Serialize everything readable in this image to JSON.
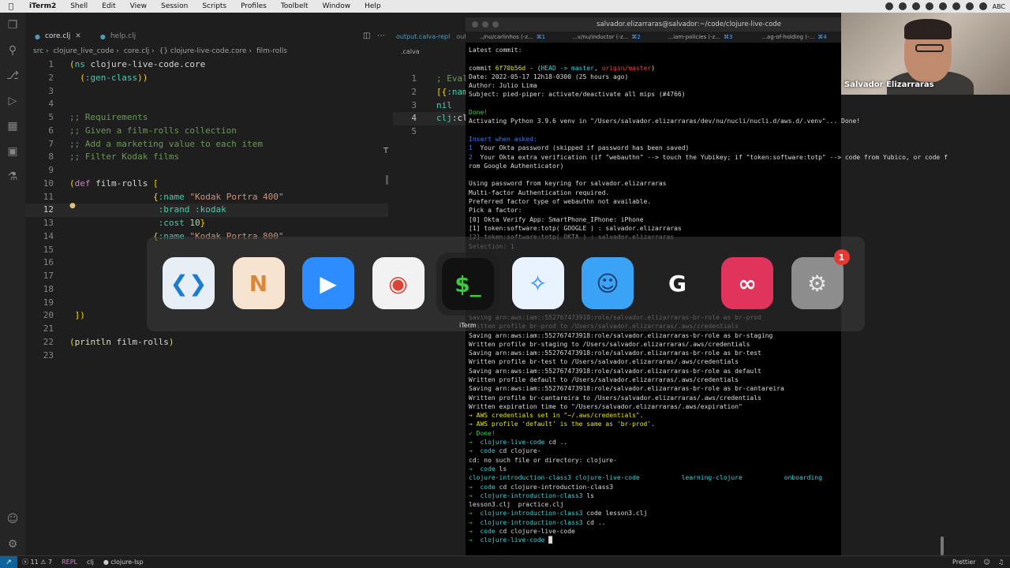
{
  "menubar": {
    "items": [
      "iTerm2",
      "Shell",
      "Edit",
      "View",
      "Session",
      "Scripts",
      "Profiles",
      "Toolbelt",
      "Window",
      "Help"
    ],
    "input_source": "ABC"
  },
  "editor": {
    "tabs": [
      {
        "label": "core.clj",
        "active": true
      },
      {
        "label": "help.clj",
        "active": false
      }
    ],
    "breadcrumb": [
      "src",
      "clojure_live_code",
      "core.clj",
      "{} clojure-live-code.core",
      "film-rolls"
    ],
    "lines": [
      {
        "n": "1",
        "parts": [
          [
            "k-paren",
            "("
          ],
          [
            "k-kw",
            "ns "
          ],
          [
            "",
            "clojure-live-code.core"
          ]
        ]
      },
      {
        "n": "2",
        "parts": [
          [
            "",
            "  "
          ],
          [
            "k-paren",
            "("
          ],
          [
            "k-kw",
            ":gen-class"
          ],
          [
            "k-paren",
            ")"
          ],
          [
            "k-paren",
            ")"
          ]
        ]
      },
      {
        "n": "3",
        "parts": []
      },
      {
        "n": "4",
        "parts": []
      },
      {
        "n": "5",
        "parts": [
          [
            "k-cm",
            ";; Requirements"
          ]
        ]
      },
      {
        "n": "6",
        "parts": [
          [
            "k-cm",
            ";; Given a film-rolls collection"
          ]
        ]
      },
      {
        "n": "7",
        "parts": [
          [
            "k-cm",
            ";; Add a marketing value to each item"
          ]
        ]
      },
      {
        "n": "8",
        "parts": [
          [
            "k-cm",
            ";; Filter Kodak films"
          ]
        ]
      },
      {
        "n": "9",
        "parts": []
      },
      {
        "n": "10",
        "parts": [
          [
            "k-paren",
            "("
          ],
          [
            "k-def",
            "def "
          ],
          [
            "",
            "film-rolls "
          ],
          [
            "k-paren",
            "["
          ]
        ]
      },
      {
        "n": "11",
        "parts": [
          [
            "",
            "                "
          ],
          [
            "k-paren",
            "{"
          ],
          [
            "k-kw",
            ":name "
          ],
          [
            "k-str",
            "\"Kodak Portra 400\""
          ]
        ]
      },
      {
        "n": "12",
        "parts": [
          [
            "",
            "                 "
          ],
          [
            "k-kw",
            ":brand :kodak"
          ]
        ],
        "current": true
      },
      {
        "n": "13",
        "parts": [
          [
            "",
            "                 "
          ],
          [
            "k-kw",
            ":cost "
          ],
          [
            "k-num",
            "10"
          ],
          [
            "k-paren",
            "}"
          ]
        ]
      },
      {
        "n": "14",
        "parts": [
          [
            "",
            "                "
          ],
          [
            "k-paren",
            "{"
          ],
          [
            "k-kw",
            ":name "
          ],
          [
            "k-str",
            "\"Kodak Portra 800\""
          ]
        ]
      },
      {
        "n": "15",
        "parts": []
      },
      {
        "n": "16",
        "parts": []
      },
      {
        "n": "17",
        "parts": []
      },
      {
        "n": "18",
        "parts": []
      },
      {
        "n": "19",
        "parts": []
      },
      {
        "n": "20",
        "parts": [
          [
            "",
            " "
          ],
          [
            "k-paren",
            "]"
          ],
          [
            "k-paren",
            ")"
          ]
        ]
      },
      {
        "n": "21",
        "parts": []
      },
      {
        "n": "22",
        "parts": [
          [
            "k-paren",
            "("
          ],
          [
            "k-fn",
            "println "
          ],
          [
            "",
            "film-rolls"
          ],
          [
            "k-paren",
            ")"
          ]
        ]
      },
      {
        "n": "23",
        "parts": []
      }
    ],
    "right_tabs": [
      "output.calva-repl",
      "output-window"
    ],
    "right_crumb": ".calva",
    "right_lines": [
      {
        "n": "1",
        "parts": [
          [
            "k-cm",
            "; Eval"
          ]
        ]
      },
      {
        "n": "2",
        "parts": [
          [
            "k-paren",
            "[{"
          ],
          [
            "k-kw",
            ":name"
          ]
        ]
      },
      {
        "n": "3",
        "parts": [
          [
            "k-kw",
            "nil"
          ]
        ]
      },
      {
        "n": "4",
        "parts": [
          [
            "k-kw",
            "clj"
          ],
          [
            "",
            ":cl"
          ]
        ],
        "current": true
      },
      {
        "n": "5",
        "parts": []
      }
    ]
  },
  "statusbar": {
    "problems": "ⓧ 11 ⚠ 7",
    "repl": "REPL",
    "lang": "clj",
    "lsp": "● clojure-lsp",
    "prettier": "Prettier"
  },
  "iterm": {
    "title": "salvador.elizarraras@salvador:~/code/clojure-live-code",
    "tabs": [
      {
        "label": "../nu/carlinhos (-z...",
        "shortcut": "⌘1"
      },
      {
        "label": "...v/nu/inductor (-z...",
        "shortcut": "⌘2"
      },
      {
        "label": "...iam-policies (-z...",
        "shortcut": "⌘3"
      },
      {
        "label": "...ag-of-holding (-...",
        "shortcut": "⌘4"
      }
    ],
    "lines": [
      [
        [
          "",
          "Latest commit:"
        ]
      ],
      [],
      [
        [
          "",
          "commit "
        ],
        [
          "t-yellow",
          "6f70b56d"
        ],
        [
          "",
          " - ("
        ],
        [
          "t-cyan",
          "HEAD -> master"
        ],
        [
          "",
          ", "
        ],
        [
          "t-red",
          "origin/master"
        ],
        [
          "",
          ")"
        ]
      ],
      [
        [
          "",
          "Date: 2022-05-17 12h18-0300 (25 hours ago)"
        ]
      ],
      [
        [
          "",
          "Author: Julio Lima"
        ]
      ],
      [
        [
          "",
          "Subject: pied-piper: activate/deactivate all mips (#4766)"
        ]
      ],
      [],
      [
        [
          "t-green",
          "Done!"
        ]
      ],
      [
        [
          "",
          "Activating Python 3.9.6 venv in \"/Users/salvador.elizarraras/dev/nu/nucli/nucli.d/aws.d/.venv\"... Done!"
        ]
      ],
      [],
      [
        [
          "t-blue",
          "Insert when asked:"
        ]
      ],
      [
        [
          "t-blue",
          "1"
        ],
        [
          "",
          "  Your Okta password (skipped if password has been saved)"
        ]
      ],
      [
        [
          "t-blue",
          "2"
        ],
        [
          "",
          "  Your Okta extra verification (if \"webauthn\" --> touch the Yubikey; if \"token:software:totp\" --> code from Yubico, or code f"
        ]
      ],
      [
        [
          "",
          "rom Google Authenticator)"
        ]
      ],
      [],
      [
        [
          "",
          "Using password from keyring for salvador.elizarraras"
        ]
      ],
      [
        [
          "",
          "Multi-factor Authentication required."
        ]
      ],
      [
        [
          "",
          "Preferred factor type of webauthn not available."
        ]
      ],
      [
        [
          "",
          "Pick a factor:"
        ]
      ],
      [
        [
          "",
          "[0] Okta Verify App: SmartPhone_IPhone: iPhone"
        ]
      ],
      [
        [
          "",
          "[1] token:software:totp( GOOGLE ) : salvador.elizarraras"
        ]
      ],
      [
        [
          "t-dim",
          "[2] token:software:totp( OKTA ) : salvador.elizarraras"
        ]
      ],
      [
        [
          "t-dim",
          "Selection: 1"
        ]
      ],
      [],
      [],
      [],
      [],
      [],
      [],
      [],
      [
        [
          "t-dim",
          "Saving arn:aws:iam::552767473918:role/salvador.elizarraras-br-role as br-prod"
        ]
      ],
      [
        [
          "t-dim",
          "Written profile br-prod to /Users/salvador.elizarraras/.aws/credentials"
        ]
      ],
      [
        [
          "",
          "Saving arn:aws:iam::552767473918:role/salvador.elizarraras-br-role as br-staging"
        ]
      ],
      [
        [
          "",
          "Written profile br-staging to /Users/salvador.elizarraras/.aws/credentials"
        ]
      ],
      [
        [
          "",
          "Saving arn:aws:iam::552767473918:role/salvador.elizarraras-br-role as br-test"
        ]
      ],
      [
        [
          "",
          "Written profile br-test to /Users/salvador.elizarraras/.aws/credentials"
        ]
      ],
      [
        [
          "",
          "Saving arn:aws:iam::552767473918:role/salvador.elizarraras-br-role as default"
        ]
      ],
      [
        [
          "",
          "Written profile default to /Users/salvador.elizarraras/.aws/credentials"
        ]
      ],
      [
        [
          "",
          "Saving arn:aws:iam::552767473918:role/salvador.elizarraras-br-role as br-cantareira"
        ]
      ],
      [
        [
          "",
          "Written profile br-cantareira to /Users/salvador.elizarraras/.aws/credentials"
        ]
      ],
      [
        [
          "",
          "Written expiration time to \"/Users/salvador.elizarraras/.aws/expiration\""
        ]
      ],
      [
        [
          "t-yellow",
          "→ AWS credentials set in \"~/.aws/credentials\"."
        ]
      ],
      [
        [
          "t-yellow",
          "→ AWS profile 'default' is the same as 'br-prod'."
        ]
      ],
      [
        [
          "t-green",
          "✓ Done!"
        ]
      ],
      [
        [
          "t-green",
          "→  "
        ],
        [
          "t-cyan",
          "clojure-live-code"
        ],
        [
          "",
          " cd .."
        ]
      ],
      [
        [
          "t-green",
          "→  "
        ],
        [
          "t-cyan",
          "code"
        ],
        [
          "",
          " cd clojure-"
        ]
      ],
      [
        [
          "",
          "cd: no such file or directory: clojure-"
        ]
      ],
      [
        [
          "t-green",
          "→  "
        ],
        [
          "t-cyan",
          "code"
        ],
        [
          "",
          " ls"
        ]
      ],
      [
        [
          "t-cyan",
          "clojure-introduction-class3 clojure-live-code           learning-clojure           onboarding"
        ]
      ],
      [
        [
          "t-green",
          "→  "
        ],
        [
          "t-cyan",
          "code"
        ],
        [
          "",
          " cd clojure-introduction-class3"
        ]
      ],
      [
        [
          "t-green",
          "→  "
        ],
        [
          "t-cyan",
          "clojure-introduction-class3"
        ],
        [
          "",
          " ls"
        ]
      ],
      [
        [
          "",
          "lesson3.clj  practice.clj"
        ]
      ],
      [
        [
          "t-green",
          "→  "
        ],
        [
          "t-cyan",
          "clojure-introduction-class3"
        ],
        [
          "",
          " code lesson3.clj"
        ]
      ],
      [
        [
          "t-green",
          "→  "
        ],
        [
          "t-cyan",
          "clojure-introduction-class3"
        ],
        [
          "",
          " cd .."
        ]
      ],
      [
        [
          "t-green",
          "→  "
        ],
        [
          "t-cyan",
          "code"
        ],
        [
          "",
          " cd clojure-live-code"
        ]
      ],
      [
        [
          "t-green",
          "→  "
        ],
        [
          "t-cyan",
          "clojure-live-code"
        ],
        [
          "",
          " █"
        ]
      ]
    ]
  },
  "webcam": {
    "name": "Salvador Elizarraras"
  },
  "switcher": {
    "selected_label": "iTerm",
    "apps": [
      {
        "name": "vscode-icon",
        "glyph": "❮❯",
        "bg": "#e8eef5",
        "fg": "#1c7bd2"
      },
      {
        "name": "notability-icon",
        "glyph": "N",
        "bg": "#f6e3d0",
        "fg": "#d9883a"
      },
      {
        "name": "zoom-icon",
        "glyph": "▶",
        "bg": "#2d8cff",
        "fg": "#ffffff"
      },
      {
        "name": "chrome-icon",
        "glyph": "◉",
        "bg": "#f2f2f2",
        "fg": "#db4437"
      },
      {
        "name": "iterm-icon",
        "glyph": "$_",
        "bg": "#111111",
        "fg": "#3ec83e",
        "selected": true
      },
      {
        "name": "safari-icon",
        "glyph": "✧",
        "bg": "#e9f3ff",
        "fg": "#1a8cff"
      },
      {
        "name": "finder-icon",
        "glyph": "☺",
        "bg": "#3aa3f5",
        "fg": "#1b3a6b"
      },
      {
        "name": "logitech-g-icon",
        "glyph": "G",
        "bg": "transparent",
        "fg": "#ffffff"
      },
      {
        "name": "creative-cloud-icon",
        "glyph": "∞",
        "bg": "#e0345d",
        "fg": "#ffffff"
      },
      {
        "name": "system-preferences-icon",
        "glyph": "⚙",
        "bg": "#8d8d8d",
        "fg": "#e5e5e5",
        "badge": "1"
      }
    ]
  }
}
